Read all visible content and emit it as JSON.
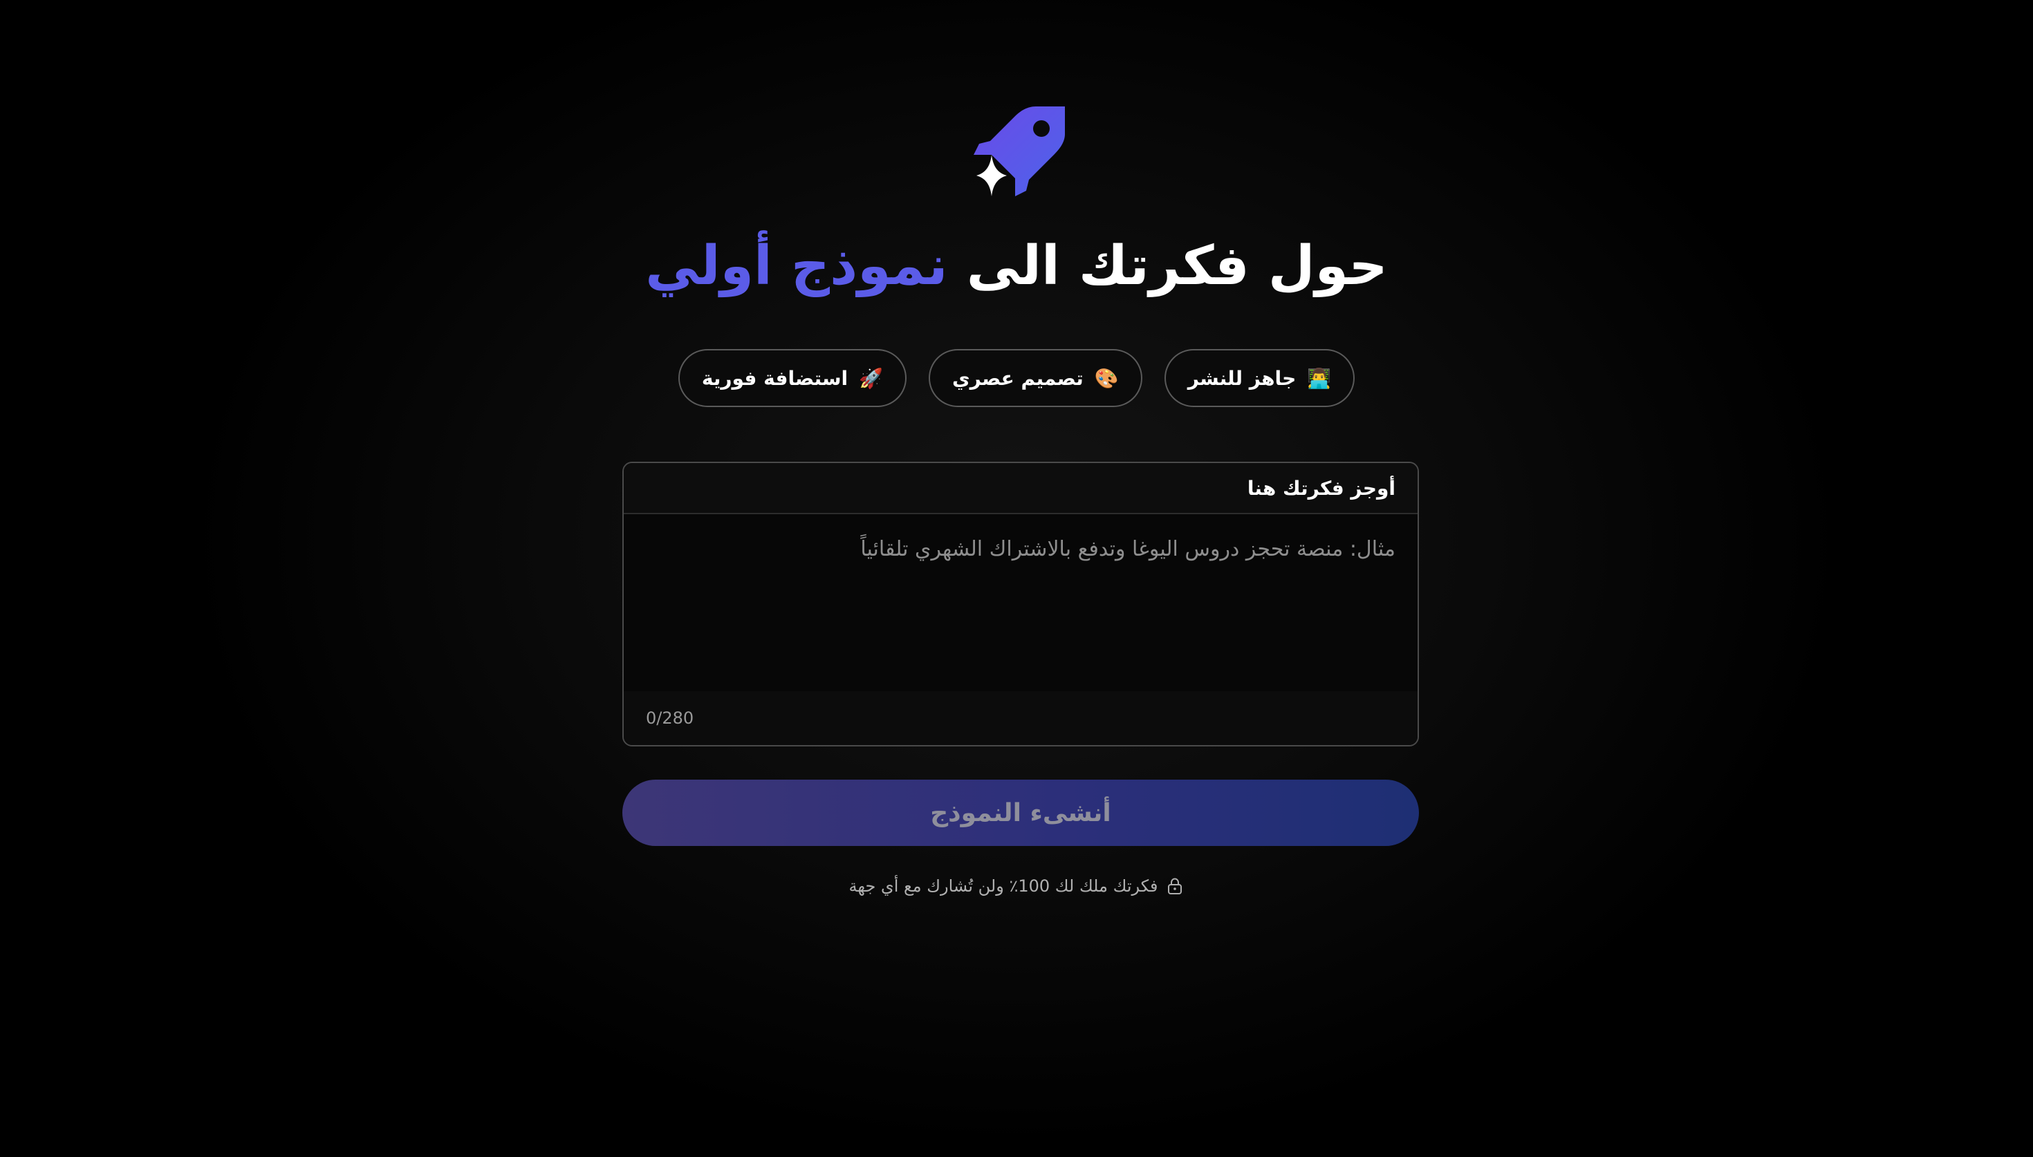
{
  "logo": {
    "icon": "rocket-sparkle-icon",
    "color": "#5b5ce8"
  },
  "headline": {
    "part1": "حول فكرتك الى ",
    "accent": "نموذج أولي",
    "accent_color": "#5b5ce8"
  },
  "features": [
    {
      "emoji": "👨‍💻",
      "label": "جاهز للنشر"
    },
    {
      "emoji": "🎨",
      "label": "تصميم عصري"
    },
    {
      "emoji": "🚀",
      "label": "استضافة فورية"
    }
  ],
  "idea_input": {
    "label": "أوجز فكرتك هنا",
    "placeholder": "مثال: منصة تحجز دروس اليوغا وتدفع بالاشتراك الشهري تلقائياً",
    "value": "",
    "counter": "0/280"
  },
  "submit": {
    "label": "أنشىء النموذج"
  },
  "privacy": {
    "icon": "lock-icon",
    "text": "فكرتك ملك لك 100٪ ولن تُشارك مع أي جهة"
  }
}
